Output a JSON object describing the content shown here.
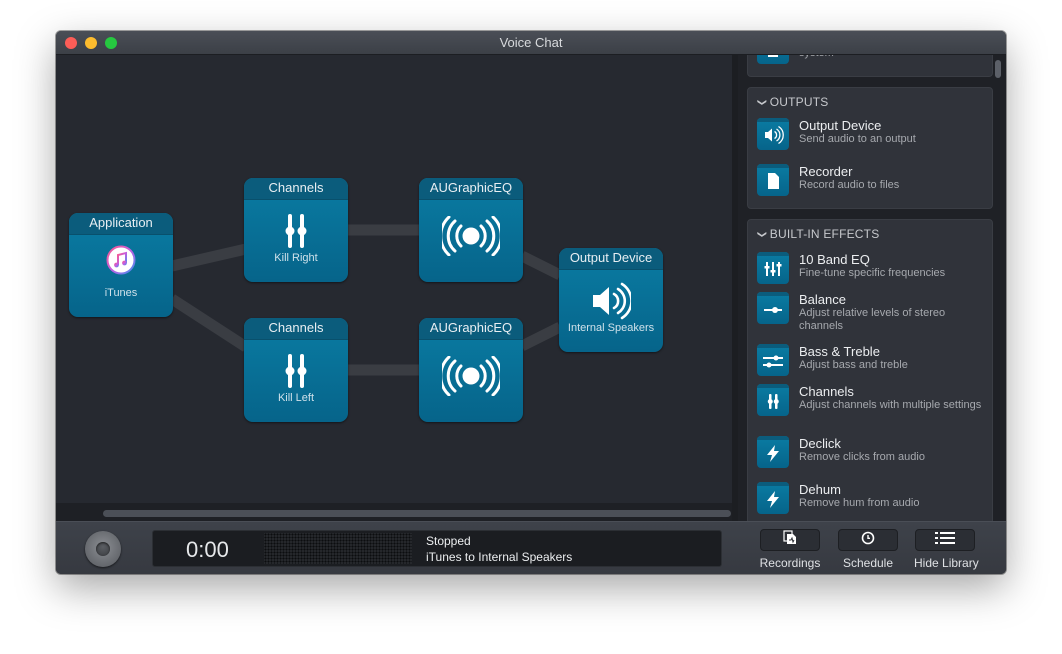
{
  "window": {
    "title": "Voice Chat"
  },
  "canvas": {
    "nodes": [
      {
        "id": "application",
        "title": "Application",
        "subtitle": "iTunes",
        "icon": "itunes-icon"
      },
      {
        "id": "channels-1",
        "title": "Channels",
        "subtitle": "Kill Right",
        "icon": "channels-sliders-icon"
      },
      {
        "id": "channels-2",
        "title": "Channels",
        "subtitle": "Kill Left",
        "icon": "channels-sliders-icon"
      },
      {
        "id": "augraphiceq-1",
        "title": "AUGraphicEQ",
        "subtitle": "",
        "icon": "audio-unit-broadcast-icon"
      },
      {
        "id": "augraphiceq-2",
        "title": "AUGraphicEQ",
        "subtitle": "",
        "icon": "audio-unit-broadcast-icon"
      },
      {
        "id": "output-device",
        "title": "Output Device",
        "subtitle": "Internal Speakers",
        "icon": "speaker-icon"
      }
    ],
    "connections": [
      [
        "application",
        "channels-1"
      ],
      [
        "application",
        "channels-2"
      ],
      [
        "channels-1",
        "augraphiceq-1"
      ],
      [
        "channels-2",
        "augraphiceq-2"
      ],
      [
        "augraphiceq-1",
        "output-device"
      ],
      [
        "augraphiceq-2",
        "output-device"
      ]
    ]
  },
  "library": {
    "partial_item": {
      "desc": "system"
    },
    "outputs": {
      "header": "OUTPUTS",
      "items": [
        {
          "name": "Output Device",
          "desc": "Send audio to an output",
          "icon": "speaker-icon"
        },
        {
          "name": "Recorder",
          "desc": "Record audio to files",
          "icon": "file-icon"
        }
      ]
    },
    "effects": {
      "header": "BUILT-IN EFFECTS",
      "items": [
        {
          "name": "10 Band EQ",
          "desc": "Fine-tune specific frequencies",
          "icon": "eq-sliders-icon"
        },
        {
          "name": "Balance",
          "desc": "Adjust relative levels of stereo channels",
          "icon": "balance-slider-icon"
        },
        {
          "name": "Bass & Treble",
          "desc": "Adjust bass and treble",
          "icon": "bass-treble-icon"
        },
        {
          "name": "Channels",
          "desc": "Adjust channels with multiple settings",
          "icon": "channels-sliders-icon"
        },
        {
          "name": "Declick",
          "desc": "Remove clicks from audio",
          "icon": "lightning-icon"
        },
        {
          "name": "Dehum",
          "desc": "Remove hum from audio",
          "icon": "lightning-icon"
        }
      ]
    }
  },
  "transport": {
    "time": "0:00",
    "status": "Stopped",
    "route": "iTunes to Internal Speakers"
  },
  "toolbar": {
    "recordings_label": "Recordings",
    "schedule_label": "Schedule",
    "hide_library_label": "Hide Library"
  }
}
